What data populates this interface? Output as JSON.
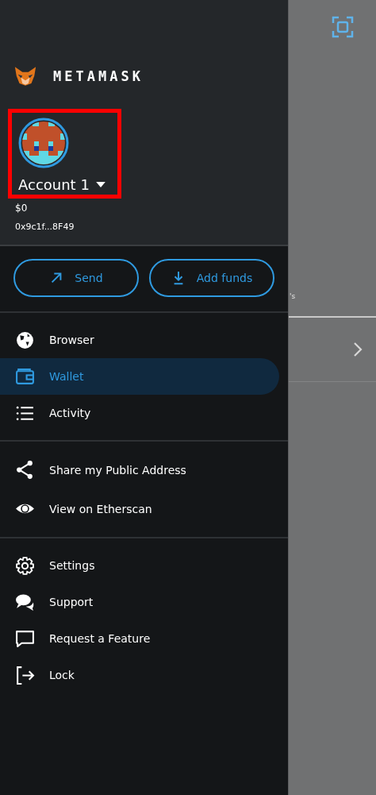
{
  "brand": {
    "name": "METAMASK"
  },
  "account": {
    "name": "Account 1",
    "balance": "$0",
    "address": "0x9c1f...8F49",
    "highlighted": true
  },
  "actions": [
    {
      "label": "Send",
      "kind": "send"
    },
    {
      "label": "Add funds",
      "kind": "add"
    }
  ],
  "menu_sections": [
    [
      {
        "label": "Browser",
        "kind": "globe",
        "selected": false
      },
      {
        "label": "Wallet",
        "kind": "wallet",
        "selected": true
      },
      {
        "label": "Activity",
        "kind": "list",
        "selected": false
      }
    ],
    [
      {
        "label": "Share my Public Address",
        "kind": "share",
        "selected": false
      },
      {
        "label": "View on Etherscan",
        "kind": "eye",
        "selected": false
      }
    ],
    [
      {
        "label": "Settings",
        "kind": "gear",
        "selected": false
      },
      {
        "label": "Support",
        "kind": "chat",
        "selected": false
      },
      {
        "label": "Request a Feature",
        "kind": "bubble",
        "selected": false
      },
      {
        "label": "Lock",
        "kind": "lock",
        "selected": false
      }
    ]
  ],
  "background": {
    "text_fragment": "'s"
  }
}
